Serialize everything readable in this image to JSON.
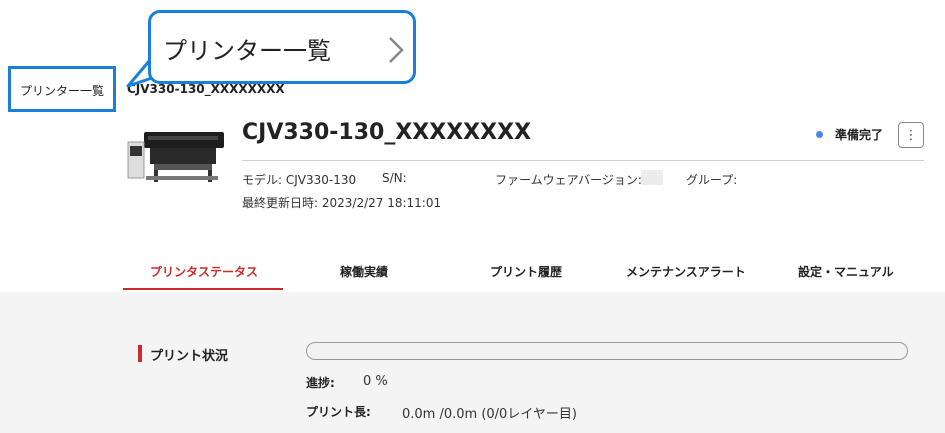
{
  "callout": {
    "text": "プリンター一覧"
  },
  "breadcrumb": {
    "link": "プリンター一覧",
    "separator": "›",
    "current": "CJV330-130_XXXXXXXX"
  },
  "printer": {
    "name": "CJV330-130_XXXXXXXX",
    "status_label": "準備完了",
    "status_color": "#4a86e8",
    "menu_icon": "kebab-menu-icon",
    "model_label": "モデル: CJV330-130",
    "serial_label": "S/N:",
    "firmware_label": "ファームウェアバージョン:",
    "group_label": "グループ:",
    "last_updated": "最終更新日時: 2023/2/27 18:11:01"
  },
  "tabs": [
    {
      "label": "プリンタステータス",
      "active": true
    },
    {
      "label": "稼働実績",
      "active": false
    },
    {
      "label": "プリント履歴",
      "active": false
    },
    {
      "label": "メンテナンスアラート",
      "active": false
    },
    {
      "label": "設定・マニュアル",
      "active": false
    }
  ],
  "print_status": {
    "title": "プリント状況",
    "progress_label": "進捗:",
    "progress_value": "0 %",
    "progress_fraction": 0,
    "length_label": "プリント長:",
    "length_value": "0.0m /0.0m (0/0レイヤー目)"
  },
  "colors": {
    "accent": "#1a7fd9",
    "active_tab": "#cc2b2b",
    "status_dot": "#4a86e8"
  }
}
